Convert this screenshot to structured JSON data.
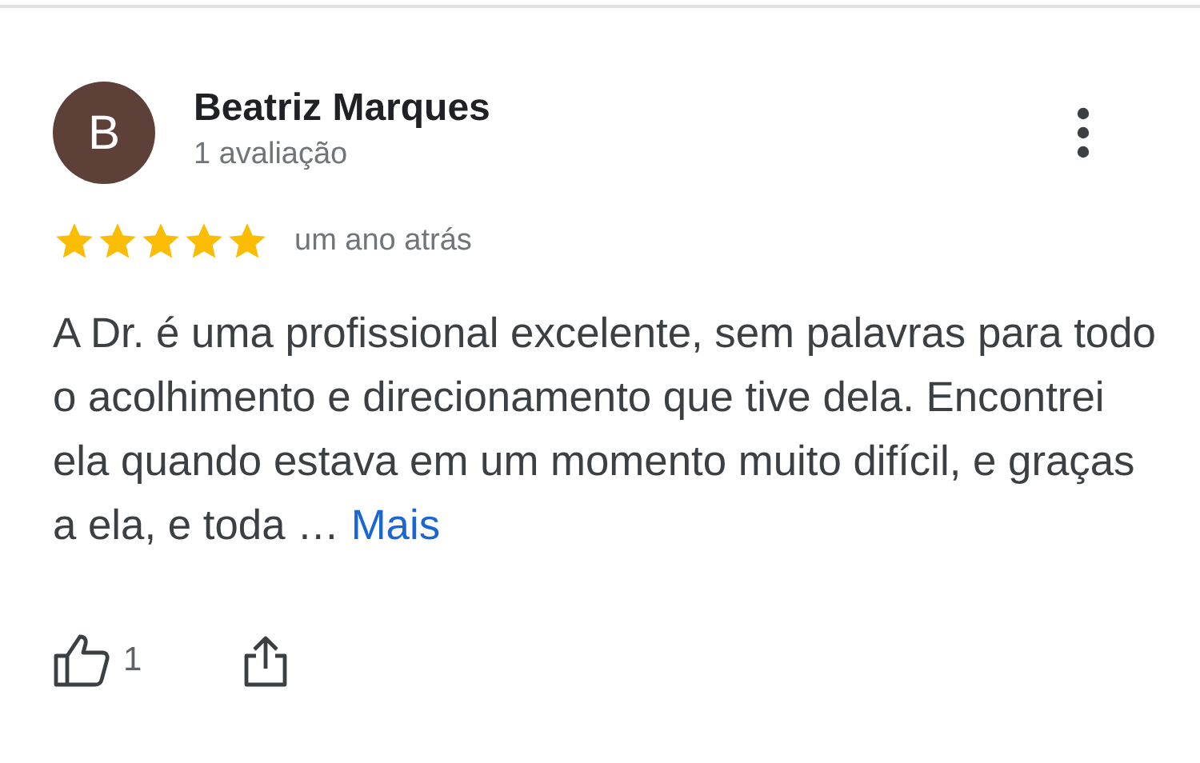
{
  "review": {
    "avatar_letter": "B",
    "author": "Beatriz Marques",
    "review_count": "1 avaliação",
    "stars": 5,
    "time": "um ano atrás",
    "text": "A Dr. é uma profissional excelente, sem palavras para todo o acolhimento e direcionamento que tive dela. Encontrei ela quando estava em um momento muito difícil, e graças a ela, e toda …",
    "more_link": "Mais",
    "likes": "1"
  }
}
